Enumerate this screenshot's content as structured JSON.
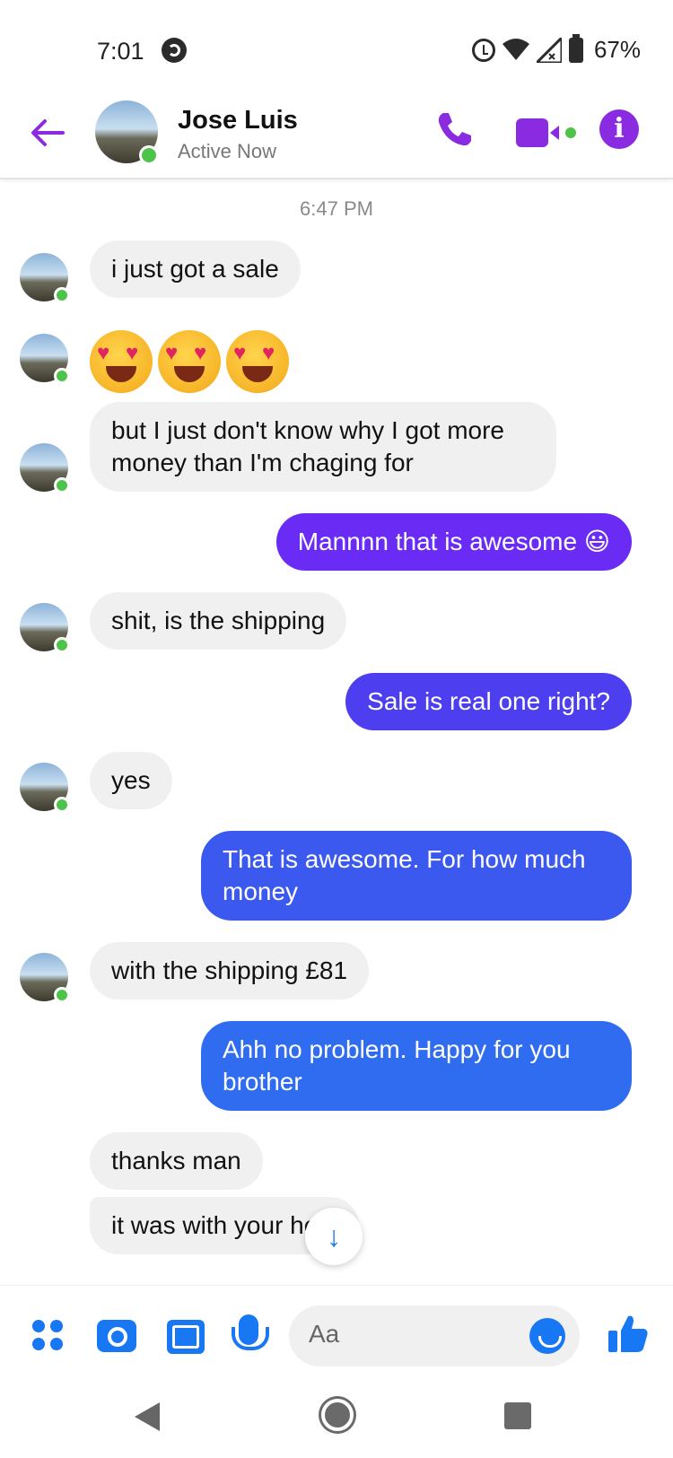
{
  "status_bar": {
    "time": "7:01",
    "battery": "67%"
  },
  "header": {
    "name": "Jose Luis",
    "status": "Active Now"
  },
  "conversation": {
    "timestamp": "6:47 PM",
    "messages": [
      {
        "from": "them",
        "text": "i just got a sale"
      },
      {
        "from": "them",
        "text": "😍😍😍"
      },
      {
        "from": "them",
        "text": "but I just don't know why I got more money than I'm chaging for"
      },
      {
        "from": "me",
        "text": "Mannnn that is awesome 😃"
      },
      {
        "from": "them",
        "text": "shit, is the shipping"
      },
      {
        "from": "me",
        "text": "Sale is real one right?"
      },
      {
        "from": "them",
        "text": "yes"
      },
      {
        "from": "me",
        "text": "That is awesome. For how much money"
      },
      {
        "from": "them",
        "text": "with the shipping £81"
      },
      {
        "from": "me",
        "text": "Ahh no problem. Happy for you brother"
      },
      {
        "from": "them",
        "text": "thanks man"
      },
      {
        "from": "them",
        "text": "it was with your help"
      }
    ]
  },
  "composer": {
    "placeholder": "Aa"
  },
  "colors": {
    "accent_purple": "#8a2be2",
    "messenger_blue": "#1877f2",
    "online_green": "#4cc44a",
    "incoming_bubble": "#f0f0f0"
  }
}
